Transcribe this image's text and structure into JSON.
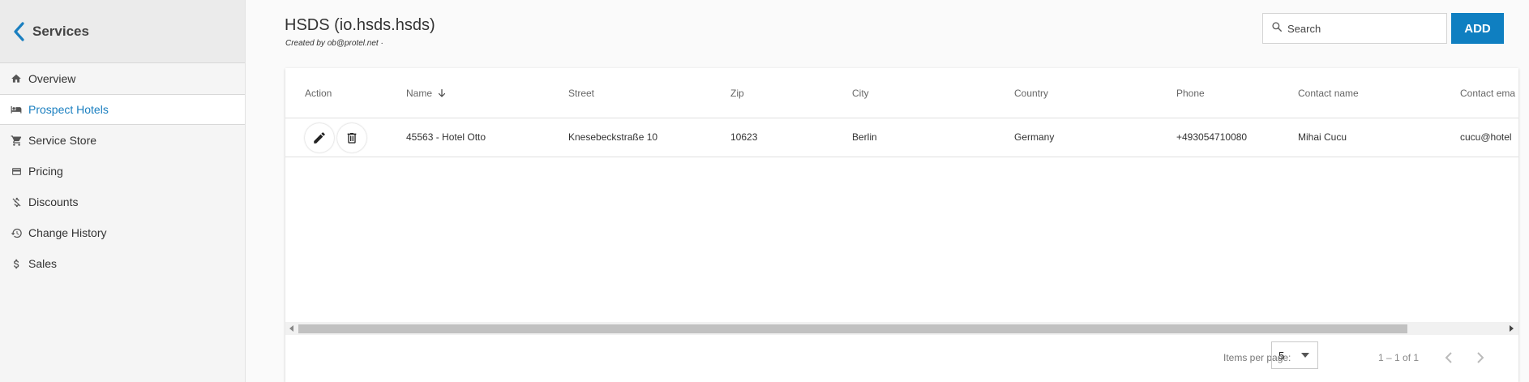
{
  "sidebar": {
    "title": "Services",
    "items": [
      {
        "label": "Overview",
        "icon": "home-icon"
      },
      {
        "label": "Prospect Hotels",
        "icon": "hotel-bed-icon",
        "active": true
      },
      {
        "label": "Service Store",
        "icon": "cart-icon"
      },
      {
        "label": "Pricing",
        "icon": "credit-card-icon"
      },
      {
        "label": "Discounts",
        "icon": "no-money-icon"
      },
      {
        "label": "Change History",
        "icon": "history-icon"
      },
      {
        "label": "Sales",
        "icon": "dollar-icon"
      }
    ]
  },
  "header": {
    "title": "HSDS (io.hsds.hsds)",
    "subtitle": "Created by ob@protel.net ·",
    "search_placeholder": "Search",
    "add_label": "ADD"
  },
  "table": {
    "columns": [
      "Action",
      "Name",
      "Street",
      "Zip",
      "City",
      "Country",
      "Phone",
      "Contact name",
      "Contact ema"
    ],
    "sorted_column": "Name",
    "sort_direction": "descending",
    "rows": [
      {
        "name": "45563 - Hotel Otto",
        "street": "Knesebeckstraße 10",
        "zip": "10623",
        "city": "Berlin",
        "country": "Germany",
        "phone": "+493054710080",
        "contact_name": "Mihai Cucu",
        "contact_email": "cucu@hotel"
      }
    ]
  },
  "pagination": {
    "items_per_page_label": "Items per page:",
    "items_per_page": "5",
    "range": "1 – 1 of 1"
  },
  "colors": {
    "accent": "#0f7fc1",
    "active_nav": "#1a7fc0"
  }
}
